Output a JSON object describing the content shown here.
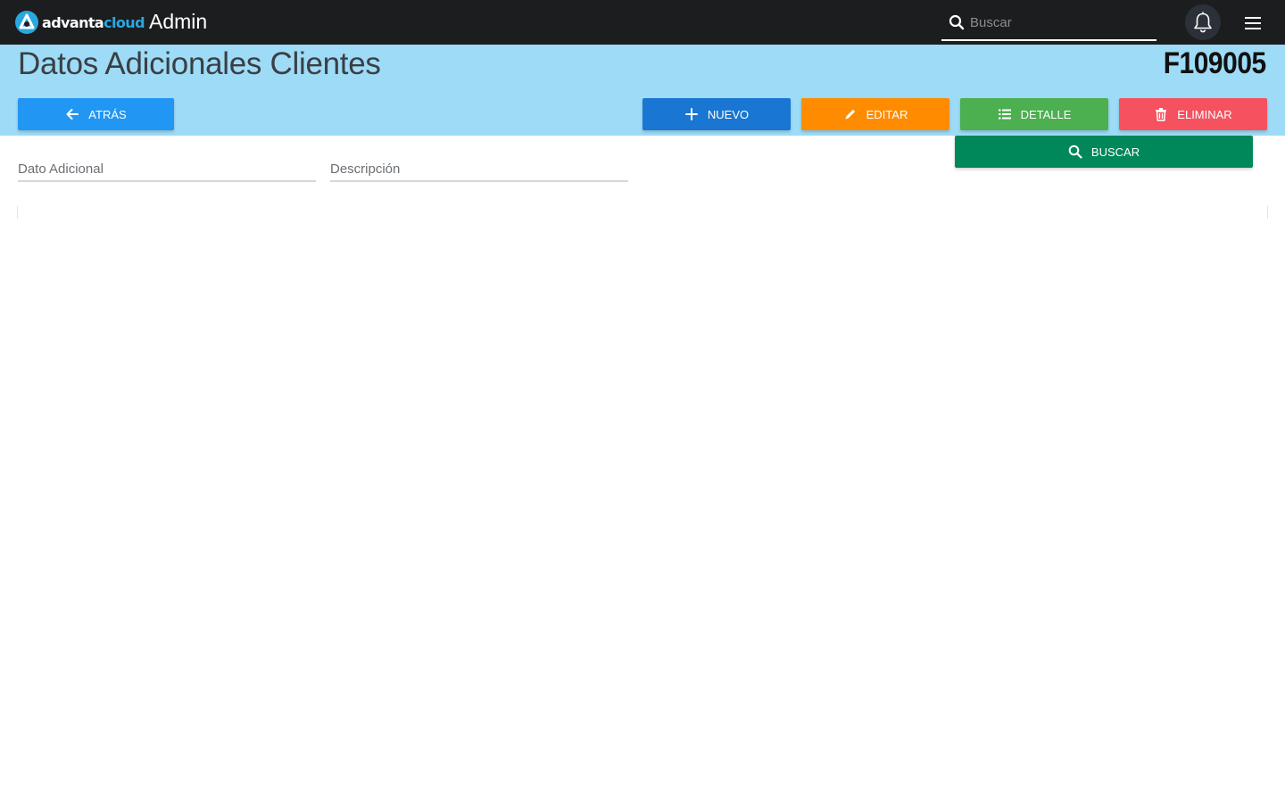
{
  "navbar": {
    "logo": {
      "part1": "advanta",
      "part2": "cloud"
    },
    "app_title": "Admin",
    "search_placeholder": "Buscar"
  },
  "header": {
    "title": "Datos Adicionales Clientes",
    "code": "F109005"
  },
  "toolbar": {
    "back_label": "ATRÁS",
    "new_label": "NUEVO",
    "edit_label": "EDITAR",
    "detail_label": "DETALLE",
    "delete_label": "ELIMINAR",
    "search_label": "BUSCAR"
  },
  "filters": {
    "dato_adicional_placeholder": "Dato Adicional",
    "descripcion_placeholder": "Descripción"
  },
  "colors": {
    "navbar": "#1c1d1f",
    "band": "#9edbf7",
    "back": "#2196f3",
    "new": "#1976d2",
    "edit": "#ff8c00",
    "detail": "#4caf50",
    "delete": "#f5515f",
    "search": "#00875a"
  },
  "icons": {
    "logo": "advanta-logo-icon",
    "search": "search-icon",
    "bell": "bell-icon",
    "menu": "hamburger-menu-icon",
    "back": "arrow-left-icon",
    "new": "plus-icon",
    "edit": "pencil-icon",
    "detail": "list-icon",
    "delete": "trash-icon"
  }
}
